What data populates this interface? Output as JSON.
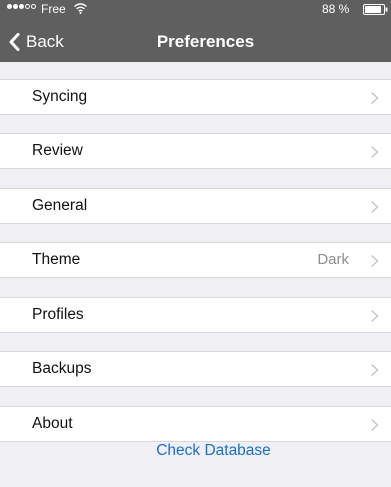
{
  "status_bar": {
    "carrier": "Free",
    "battery": "88 %",
    "signal_bars_filled": 3,
    "signal_bars_total": 5
  },
  "nav": {
    "back_label": "Back",
    "title": "Preferences"
  },
  "menu": {
    "items": [
      {
        "label": "Syncing",
        "value": ""
      },
      {
        "label": "Review",
        "value": ""
      },
      {
        "label": "General",
        "value": ""
      },
      {
        "label": "Theme",
        "value": "Dark"
      },
      {
        "label": "Profiles",
        "value": ""
      },
      {
        "label": "Backups",
        "value": ""
      },
      {
        "label": "About",
        "value": ""
      }
    ]
  },
  "footer": {
    "check_database_label": "Check Database"
  },
  "colors": {
    "header_bg": "#5f5f5f",
    "page_bg": "#efeff4",
    "link": "#1a6fcd",
    "secondary_text": "#8e8e93"
  }
}
